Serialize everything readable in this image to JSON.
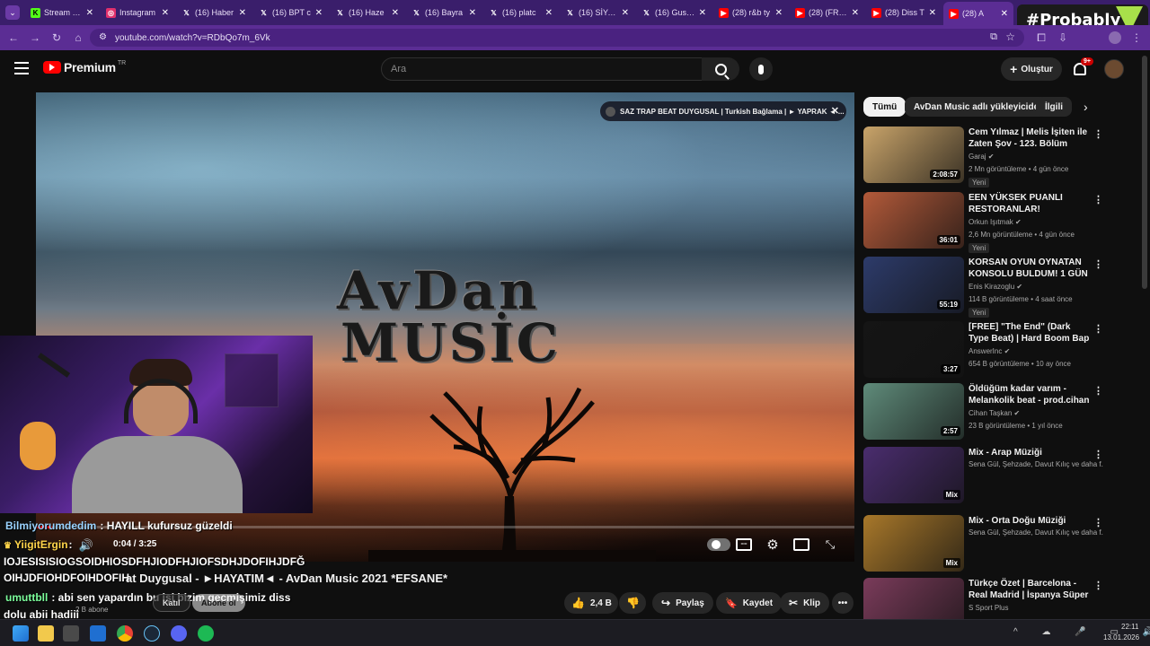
{
  "browser": {
    "tabs": [
      {
        "label": "Stream - K",
        "icon": "kick-icon",
        "color": "#53fc18"
      },
      {
        "label": "Instagram",
        "icon": "instagram-icon",
        "color": "#e1306c"
      },
      {
        "label": "(16) Haber",
        "icon": "x-icon",
        "color": "#000000"
      },
      {
        "label": "(16) BPT c",
        "icon": "x-icon",
        "color": "#000000"
      },
      {
        "label": "(16) Haze",
        "icon": "x-icon",
        "color": "#000000"
      },
      {
        "label": "(16) Bayra",
        "icon": "x-icon",
        "color": "#000000"
      },
      {
        "label": "(16) platc",
        "icon": "x-icon",
        "color": "#000000"
      },
      {
        "label": "(16) SİYAH",
        "icon": "x-icon",
        "color": "#000000"
      },
      {
        "label": "(16) Gushe",
        "icon": "x-icon",
        "color": "#000000"
      },
      {
        "label": "(28) r&b ty",
        "icon": "youtube-icon",
        "color": "#ff0000"
      },
      {
        "label": "(28) (FREE",
        "icon": "youtube-icon",
        "color": "#ff0000"
      },
      {
        "label": "(28) Diss T",
        "icon": "youtube-icon",
        "color": "#ff0000"
      },
      {
        "label": "(28) A",
        "icon": "youtube-icon",
        "color": "#ff0000"
      }
    ],
    "url": "youtube.com/watch?v=RDbQo7m_6Vk"
  },
  "overlay_brand": "#Probably",
  "youtube": {
    "logo_text": "Premium",
    "logo_sup": "TR",
    "search_placeholder": "Ara",
    "create_label": "Oluştur",
    "notif_count": "9+"
  },
  "player": {
    "thumb_line1": "AvDan",
    "thumb_line2": "MUSİC",
    "chip_text": "SAZ TRAP BEAT DUYGUSAL | Turkish Bağlama | ► YAPRAK ◄ ...",
    "time": "0:04 / 3:25",
    "progress": 0.02
  },
  "chat": [
    {
      "user": "Bilmiyorumdedim",
      "text": ": HAYILL kufursuz güzeldi",
      "color": "#9ad3ff"
    },
    {
      "user": "YiigitErgin",
      "text": ":",
      "color": "#ffd54a"
    },
    {
      "user": "",
      "text": "IOJESISISIOGSOIDHIOSDFHJIODFHJIOFSDHJDOFIHJDFĞ",
      "color": "#ffffff"
    },
    {
      "user": "",
      "text": "OIHJDFIOHDFOIHDOFIH",
      "color": "#ffffff"
    },
    {
      "user": "umuttbll",
      "text": ": abi sen yapardın bu işi bizim gecmişimiz diss",
      "color": "#7cff9c"
    },
    {
      "user": "",
      "text": "dolu abii hadiii",
      "color": "#ffffff"
    }
  ],
  "video": {
    "title_tail": "at Duygusal - ►HAYATIM◄ - AvDan Music 2021 *EFSANE*",
    "subs": "2 B abone",
    "join_label": "Katıl",
    "sub_label": "Abone ol",
    "likes": "2,4 B",
    "share": "Paylaş",
    "save": "Kaydet",
    "clip": "Klip"
  },
  "sidebar": {
    "chips": [
      "Tümü",
      "AvDan Music adlı yükleyiciden",
      "İlgili"
    ],
    "items": [
      {
        "title": "Cem Yılmaz | Melis İşiten ile Zaten Şov - 123. Bölüm",
        "channel": "Garaj",
        "verified": true,
        "meta": "2 Mn görüntüleme • 4 gün önce",
        "badge": "Yeni",
        "duration": "2:08:57",
        "thumb": "#c9a46a"
      },
      {
        "title": "EEN YÜKSEK PUANLI RESTORANLAR! @uberkuloz ...",
        "channel": "Orkun Işıtmak",
        "verified": true,
        "meta": "2,6 Mn görüntüleme • 4 gün önce",
        "badge": "Yeni",
        "duration": "36:01",
        "thumb": "#b35a3a"
      },
      {
        "title": "KORSAN OYUN OYNATAN KONSOLU BULDUM! 1 GÜN ...",
        "channel": "Enis Kirazoglu",
        "verified": true,
        "meta": "114 B görüntüleme • 4 saat önce",
        "badge": "Yeni",
        "duration": "55:19",
        "thumb": "#2d3b6a"
      },
      {
        "title": "[FREE] \"The End\" (Dark Type Beat) | Hard Boom Bap Rap Be...",
        "channel": "AnswerInc",
        "verified": true,
        "meta": "654 B görüntüleme • 10 ay önce",
        "badge": "",
        "duration": "3:27",
        "thumb": "#151515"
      },
      {
        "title": "Öldüğüm kadar varım - Melankolik beat - prod.cihan ...",
        "channel": "Cihan Taşkan",
        "verified": true,
        "meta": "23 B görüntüleme • 1 yıl önce",
        "badge": "",
        "duration": "2:57",
        "thumb": "#5f8b7a"
      },
      {
        "title": "Mix - Arap Müziği",
        "channel": "Sena Gül, Şehzade, Davut Kılıç ve daha f...",
        "verified": false,
        "meta": "",
        "badge": "",
        "duration": "Mix",
        "thumb": "#4a2d6e"
      },
      {
        "title": "Mix - Orta Doğu Müziği",
        "channel": "Sena Gül, Şehzade, Davut Kılıç ve daha f...",
        "verified": false,
        "meta": "",
        "badge": "",
        "duration": "Mix",
        "thumb": "#a8782a"
      },
      {
        "title": "Türkçe Özet | Barcelona - Real Madrid | İspanya Süper Kupası...",
        "channel": "S Sport Plus",
        "verified": false,
        "meta": "",
        "badge": "",
        "duration": "",
        "thumb": "#7a3b5a"
      }
    ]
  },
  "taskbar": {
    "time": "22:11",
    "date": "13.01.2026"
  }
}
